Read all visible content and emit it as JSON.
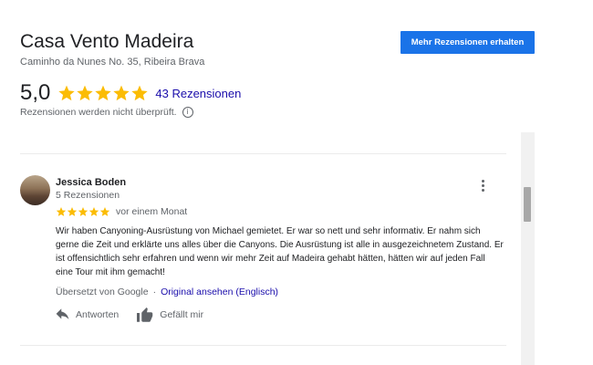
{
  "business": {
    "name": "Casa Vento Madeira",
    "address": "Caminho da Nunes No. 35, Ribeira Brava",
    "cta_label": "Mehr Rezensionen erhalten"
  },
  "summary": {
    "rating": "5,0",
    "stars": 5,
    "review_count_label": "43 Rezensionen",
    "disclaimer": "Rezensionen werden nicht überprüft.",
    "star_color": "#fbbc04"
  },
  "review": {
    "reviewer_name": "Jessica Boden",
    "reviewer_meta": "5 Rezensionen",
    "stars": 5,
    "date": "vor einem Monat",
    "text": "Wir haben Canyoning-Ausrüstung von Michael gemietet. Er war so nett und sehr informativ. Er nahm sich gerne die Zeit und erklärte uns alles über die Canyons. Die Ausrüstung ist alle in ausgezeichnetem Zustand. Er ist offensichtlich sehr erfahren und wenn wir mehr Zeit auf Madeira gehabt hätten, hätten wir auf jeden Fall eine Tour mit ihm gemacht!",
    "translated_by": "Übersetzt von Google",
    "separator": "·",
    "original_link": "Original ansehen (Englisch)",
    "reply_label": "Antworten",
    "like_label": "Gefällt mir"
  },
  "colors": {
    "accent": "#1a73e8",
    "link": "#1a0dab",
    "secondary_text": "#5f6368"
  }
}
